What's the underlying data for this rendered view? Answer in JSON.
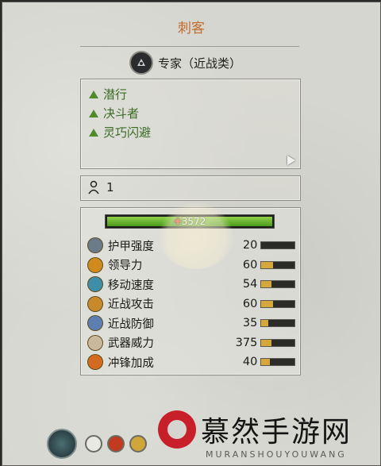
{
  "unit": {
    "name": "刺客",
    "class_label": "专家（近战类）",
    "class_icon": "hooded-figure-icon",
    "count": "1"
  },
  "traits": [
    {
      "label": "潜行"
    },
    {
      "label": "决斗者"
    },
    {
      "label": "灵巧闪避"
    }
  ],
  "health": {
    "value": "3572",
    "fraction": 1.0,
    "color": "#6fb833"
  },
  "stats": [
    {
      "name": "护甲强度",
      "value": "20",
      "fraction": 0.0,
      "icon": "armor-icon",
      "color": "#6b7b8a"
    },
    {
      "name": "领导力",
      "value": "60",
      "fraction": 0.35,
      "icon": "leadership-icon",
      "color": "#d08a1d"
    },
    {
      "name": "移动速度",
      "value": "54",
      "fraction": 0.3,
      "icon": "speed-icon",
      "color": "#3f8ea8"
    },
    {
      "name": "近战攻击",
      "value": "60",
      "fraction": 0.35,
      "icon": "melee-attack-icon",
      "color": "#c8892a"
    },
    {
      "name": "近战防御",
      "value": "35",
      "fraction": 0.2,
      "icon": "melee-defense-icon",
      "color": "#5a7fb0"
    },
    {
      "name": "武器威力",
      "value": "375",
      "fraction": 0.3,
      "icon": "weapon-strength-icon",
      "color": "#c9b89b"
    },
    {
      "name": "冲锋加成",
      "value": "40",
      "fraction": 0.25,
      "icon": "charge-bonus-icon",
      "color": "#d46a1f"
    }
  ],
  "abilities": [
    {
      "icon": "portrait-icon"
    },
    {
      "icon": "shield-ability-icon"
    },
    {
      "icon": "fist-ability-icon"
    },
    {
      "icon": "eye-ability-icon"
    },
    {
      "icon": "dark-ability-icon"
    }
  ],
  "watermark": {
    "text": "慕然手游网",
    "sub": "MURANSHOUYOUWANG"
  },
  "colors": {
    "title": "#c36a2d",
    "trait_text": "#3a6b25",
    "stat_bar_fill": "#d6a73a"
  }
}
